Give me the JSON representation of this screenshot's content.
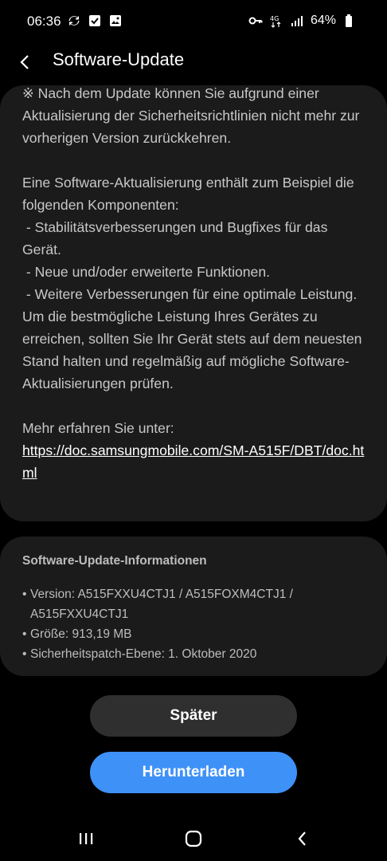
{
  "status_bar": {
    "time": "06:36",
    "battery": "64%",
    "network": "4G"
  },
  "header": {
    "title": "Software-Update"
  },
  "release_notes": {
    "paragraph1": "※ Nach dem Update können Sie aufgrund einer Aktualisierung der Sicherheitsrichtlinien nicht mehr zur vorherigen Version zurückkehren.",
    "paragraph2": "Eine Software-Aktualisierung enthält zum Beispiel die folgenden Komponenten:\n - Stabilitätsverbesserungen und Bugfixes für das Gerät.\n - Neue und/oder erweiterte Funktionen.\n - Weitere Verbesserungen für eine optimale Leistung.\nUm die bestmögliche Leistung Ihres Gerätes zu erreichen, sollten Sie Ihr Gerät stets auf dem neuesten Stand halten und regelmäßig auf mögliche Software-Aktualisierungen prüfen.",
    "more_info_label": "Mehr erfahren Sie unter:",
    "link": "https://doc.samsungmobile.com/SM-A515F/DBT/doc.html"
  },
  "update_info": {
    "title": "Software-Update-Informationen",
    "version": "Version: A515FXXU4CTJ1 / A515FOXM4CTJ1 / A515FXXU4CTJ1",
    "size": "Größe: 913,19 MB",
    "security_patch": "Sicherheitspatch-Ebene: 1. Oktober 2020"
  },
  "buttons": {
    "later": "Später",
    "download": "Herunterladen"
  },
  "colors": {
    "background": "#000000",
    "card": "#1b1b1b",
    "accent": "#3e91f7",
    "secondary_button": "#2f2f2f"
  },
  "icons": {
    "status_left": [
      "sync-icon",
      "checkbox-icon",
      "image-icon"
    ],
    "status_right": [
      "vpn-key-icon",
      "network-4g-icon",
      "signal-icon",
      "battery-icon"
    ],
    "nav": [
      "recents-icon",
      "home-icon",
      "back-icon"
    ]
  }
}
